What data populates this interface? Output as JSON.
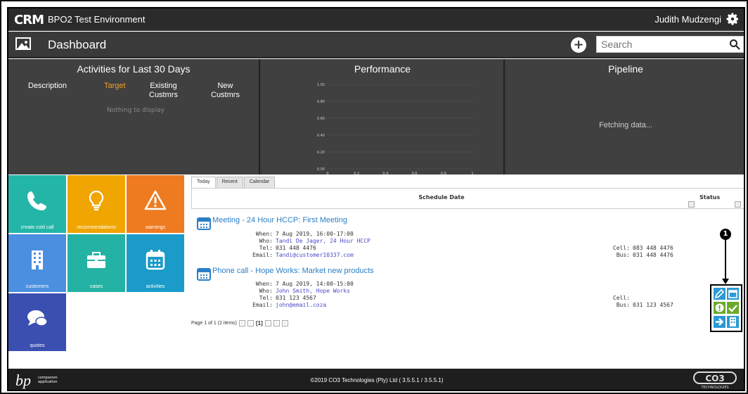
{
  "topbar": {
    "logo": "CRM",
    "app_title": "BPO2 Test Environment",
    "user_name": "Judith Mudzengi"
  },
  "header": {
    "title": "Dashboard",
    "search_placeholder": "Search"
  },
  "panels": {
    "activities": {
      "title": "Activities for Last 30 Days",
      "columns": [
        "Description",
        "Target",
        "Existing\nCustmrs",
        "New\nCustmrs"
      ],
      "empty": "Nothing to display"
    },
    "performance": {
      "title": "Performance"
    },
    "pipeline": {
      "title": "Pipeline",
      "status": "Fetching data..."
    }
  },
  "chart_data": {
    "type": "line",
    "title": "Performance",
    "xlim": [
      0,
      1
    ],
    "ylim": [
      0,
      1
    ],
    "x_ticks": [
      "0",
      "0.2",
      "0.4",
      "0.6",
      "0.8",
      "1"
    ],
    "y_ticks": [
      "0.00",
      "0.20",
      "0.40",
      "0.60",
      "0.80",
      "1.00"
    ],
    "series": [],
    "grid": true
  },
  "tiles": [
    {
      "label": "create cold call",
      "icon": "phone-icon",
      "color": "#23b5a8"
    },
    {
      "label": "recommendations",
      "icon": "lightbulb-icon",
      "color": "#f0a500"
    },
    {
      "label": "warnings",
      "icon": "warning-icon",
      "color": "#ef7b20"
    },
    {
      "label": "customers",
      "icon": "building-icon",
      "color": "#4a8fe0"
    },
    {
      "label": "cases",
      "icon": "briefcase-icon",
      "color": "#24b2a4"
    },
    {
      "label": "activities",
      "icon": "calendar-icon",
      "color": "#1a9bc9"
    },
    {
      "label": "quotes",
      "icon": "chat-icon",
      "color": "#3a4fb0"
    }
  ],
  "schedule": {
    "tabs": [
      "Today",
      "Recent",
      "Calendar"
    ],
    "col_schedule": "Schedule Date",
    "col_status": "Status",
    "entries": [
      {
        "title": "Meeting - 24 Hour HCCP: First Meeting",
        "when_label": "When:",
        "when": "7 Aug 2019, 16:00-17:00",
        "who_label": "Who:",
        "who": "Tandi De Jager, 24 Hour HCCP",
        "tel_label": "Tel:",
        "tel": "031 448 4476",
        "email_label": "Email:",
        "email": "Tandi@customer10337.com",
        "cell_label": "Cell:",
        "cell": "083 448 4476",
        "bus_label": "Bus:",
        "bus": "031 448 4476"
      },
      {
        "title": "Phone call - Hope Works: Market new products",
        "when_label": "When:",
        "when": "7 Aug 2019, 14:00-15:00",
        "who_label": "Who:",
        "who": "John Smith, Hope Works",
        "tel_label": "Tel:",
        "tel": "031 123 4567",
        "email_label": "Email:",
        "email": "john@email.coza",
        "cell_label": "Cell:",
        "cell": "",
        "bus_label": "Bus:",
        "bus": "031 123 4567"
      }
    ],
    "pager_text": "Page 1 of 1 (2 items)",
    "current_page": "[1]"
  },
  "annotation": {
    "marker": "1"
  },
  "footer": {
    "copyright": "©2019 CO3 Technologies (Pty) Ltd ( 3.5.5.1 / 3.5.5.1)",
    "bp_logo": "bp",
    "bp_sub_a": "companion",
    "bp_sub_b": "application",
    "co3_logo": "CO3",
    "co3_sub": "TECHNOLOGIES"
  }
}
